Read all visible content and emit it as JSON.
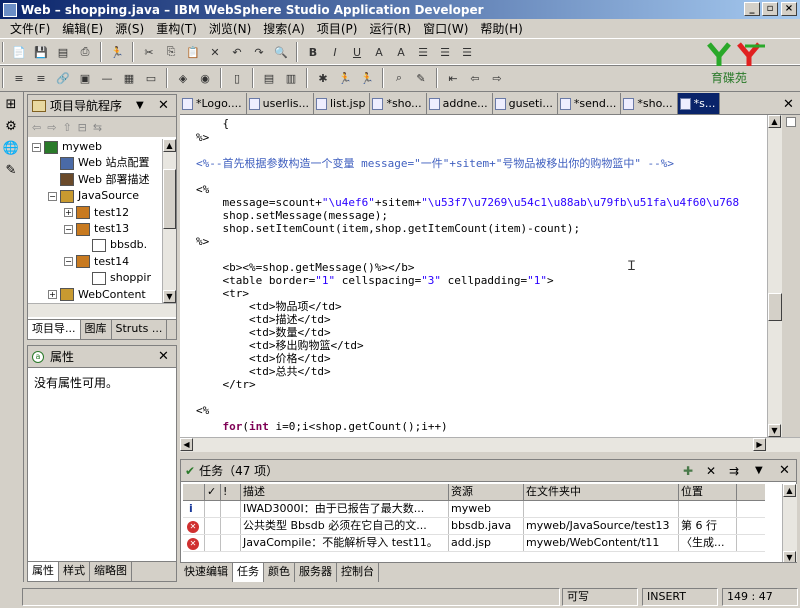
{
  "window": {
    "title": "Web – shopping.java – IBM WebSphere Studio Application Developer"
  },
  "menu": [
    "文件(F)",
    "编辑(E)",
    "源(S)",
    "重构(T)",
    "浏览(N)",
    "搜索(A)",
    "项目(P)",
    "运行(R)",
    "窗口(W)",
    "帮助(H)"
  ],
  "logo_text": "育碟苑",
  "navigator": {
    "title": "项目导航程序",
    "tree": [
      {
        "label": "myweb",
        "level": 0,
        "exp": "−",
        "icon": "project-icon"
      },
      {
        "label": "Web 站点配置",
        "level": 1,
        "exp": "",
        "icon": "site-config-icon"
      },
      {
        "label": "Web 部署描述",
        "level": 1,
        "exp": "",
        "icon": "deploy-descriptor-icon"
      },
      {
        "label": "JavaSource",
        "level": 1,
        "exp": "−",
        "icon": "source-folder-icon"
      },
      {
        "label": "test12",
        "level": 2,
        "exp": "+",
        "icon": "package-icon"
      },
      {
        "label": "test13",
        "level": 2,
        "exp": "−",
        "icon": "package-icon"
      },
      {
        "label": "bbsdb.",
        "level": 3,
        "exp": "",
        "icon": "java-file-icon"
      },
      {
        "label": "test14",
        "level": 2,
        "exp": "−",
        "icon": "package-icon"
      },
      {
        "label": "shoppir",
        "level": 3,
        "exp": "",
        "icon": "java-file-icon"
      },
      {
        "label": "WebContent",
        "level": 1,
        "exp": "+",
        "icon": "folder-icon"
      }
    ],
    "tabs": [
      "项目导...",
      "图库",
      "Struts ..."
    ]
  },
  "properties": {
    "title": "属性",
    "empty_text": "没有属性可用。",
    "tabs": [
      "属性",
      "样式",
      "缩略图"
    ]
  },
  "editor": {
    "tabs": [
      "*Logo....",
      "userlis...",
      "list.jsp",
      "*sho...",
      "addne...",
      "guseti...",
      "*send...",
      "*sho...",
      "*s..."
    ],
    "active_tab_index": 8
  },
  "tasks": {
    "title": "任务（47 项）",
    "columns": [
      "",
      "✓",
      "!",
      "描述",
      "资源",
      "在文件夹中",
      "位置"
    ],
    "rows": [
      {
        "type": "info",
        "desc": "IWAD3000I：由于已报告了最大数...",
        "resource": "myweb",
        "folder": "",
        "location": ""
      },
      {
        "type": "error",
        "desc": "公共类型 Bbsdb 必须在它自己的文...",
        "resource": "bbsdb.java",
        "folder": "myweb/JavaSource/test13",
        "location": "第 6 行"
      },
      {
        "type": "error",
        "desc": "JavaCompile：不能解析导入 test11。",
        "resource": "add.jsp",
        "folder": "myweb/WebContent/t11",
        "location": "〈生成..."
      }
    ],
    "bottom_tabs": [
      "快速编辑",
      "任务",
      "颜色",
      "服务器",
      "控制台"
    ]
  },
  "status": {
    "writable": "可写",
    "mode": "INSERT",
    "position": "149 : 47"
  }
}
